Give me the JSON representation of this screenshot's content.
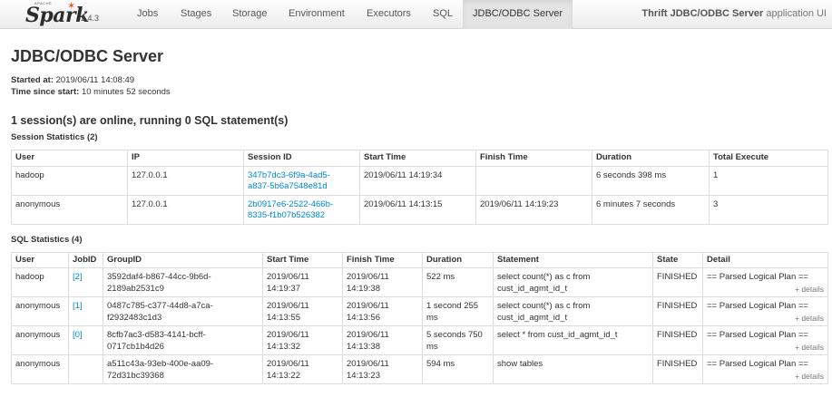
{
  "brand": {
    "name": "Spark",
    "apache_label": "APACHE",
    "version": "2.4.3"
  },
  "nav": {
    "tabs": [
      {
        "label": "Jobs"
      },
      {
        "label": "Stages"
      },
      {
        "label": "Storage"
      },
      {
        "label": "Environment"
      },
      {
        "label": "Executors"
      },
      {
        "label": "SQL"
      },
      {
        "label": "JDBC/ODBC Server",
        "active": true
      }
    ],
    "app_title_bold": "Thrift JDBC/ODBC Server",
    "app_title_suffix": " application UI"
  },
  "page": {
    "title": "JDBC/ODBC Server",
    "started_label": "Started at:",
    "started_value": " 2019/06/11 14:08:49",
    "since_label": "Time since start:",
    "since_value": " 10 minutes 52 seconds",
    "summary": "1 session(s) are online, running 0 SQL statement(s)"
  },
  "session_stats": {
    "title": "Session Statistics (2)",
    "headers": [
      "User",
      "IP",
      "Session ID",
      "Start Time",
      "Finish Time",
      "Duration",
      "Total Execute"
    ],
    "rows": [
      {
        "user": "hadoop",
        "ip": "127.0.0.1",
        "session_id_1": "347b7dc3-6f9a-4ad5-",
        "session_id_2": "a837-5b6a7548e81d",
        "start": "2019/06/11 14:19:34",
        "finish": "",
        "duration": "6 seconds 398 ms",
        "total": "1"
      },
      {
        "user": "anonymous",
        "ip": "127.0.0.1",
        "session_id_1": "2b0917e6-2522-466b-",
        "session_id_2": "8335-f1b07b526382",
        "start": "2019/06/11 14:13:15",
        "finish": "2019/06/11 14:19:23",
        "duration": "6 minutes 7 seconds",
        "total": "3"
      }
    ]
  },
  "sql_stats": {
    "title": "SQL Statistics (4)",
    "headers": [
      "User",
      "JobID",
      "GroupID",
      "Start Time",
      "Finish Time",
      "Duration",
      "Statement",
      "State",
      "Detail"
    ],
    "rows": [
      {
        "user": "hadoop",
        "jobid": "[2]",
        "group_1": "3592daf4-b867-44cc-9b6d-",
        "group_2": "2189ab2531c9",
        "start_1": "2019/06/11",
        "start_2": "14:19:37",
        "finish_1": "2019/06/11",
        "finish_2": "14:19:38",
        "duration": "522 ms",
        "stmt_1": "select count(*) as c from",
        "stmt_2": "cust_id_agmt_id_t",
        "state": "FINISHED",
        "detail": "== Parsed Logical Plan ==",
        "details_link": "+ details"
      },
      {
        "user": "anonymous",
        "jobid": "[1]",
        "group_1": "0487c785-c377-44d8-a7ca-",
        "group_2": "f2932483c1d3",
        "start_1": "2019/06/11",
        "start_2": "14:13:55",
        "finish_1": "2019/06/11",
        "finish_2": "14:13:56",
        "duration": "1 second 255 ms",
        "stmt_1": "select count(*) as c from",
        "stmt_2": "cust_id_agmt_id_t",
        "state": "FINISHED",
        "detail": "== Parsed Logical Plan ==",
        "details_link": "+ details"
      },
      {
        "user": "anonymous",
        "jobid": "[0]",
        "group_1": "8cfb7ac3-d583-4141-bcff-",
        "group_2": "0717cb1b4d26",
        "start_1": "2019/06/11",
        "start_2": "14:13:32",
        "finish_1": "2019/06/11",
        "finish_2": "14:13:38",
        "duration": "5 seconds 750 ms",
        "stmt_1": "select * from cust_id_agmt_id_t",
        "stmt_2": "",
        "state": "FINISHED",
        "detail": "== Parsed Logical Plan ==",
        "details_link": "+ details"
      },
      {
        "user": "anonymous",
        "jobid": "",
        "group_1": "a511c43a-93eb-400e-aa09-",
        "group_2": "72d31bc39368",
        "start_1": "2019/06/11",
        "start_2": "14:13:22",
        "finish_1": "2019/06/11",
        "finish_2": "14:13:23",
        "duration": "594 ms",
        "stmt_1": "show tables",
        "stmt_2": "",
        "state": "FINISHED",
        "detail": "== Parsed Logical Plan ==",
        "details_link": "+ details"
      }
    ]
  }
}
